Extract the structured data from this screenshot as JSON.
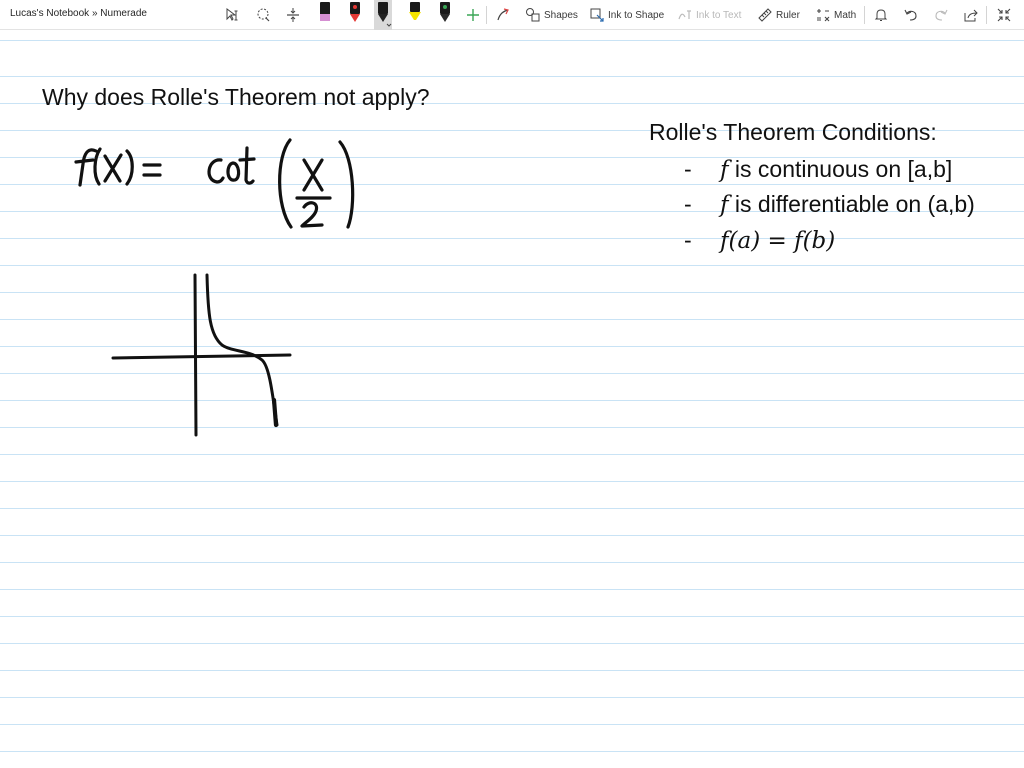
{
  "toolbar": {
    "breadcrumb": "Lucas's Notebook » Numerade",
    "shapes_label": "Shapes",
    "ink_to_shape_label": "Ink to Shape",
    "ink_to_text_label": "Ink to Text",
    "ruler_label": "Ruler",
    "math_label": "Math",
    "pen_colors": [
      "#d58fd2",
      "#e53935",
      "#222222",
      "#f5e400",
      "#2a2a2a"
    ],
    "accent_color": "#3aa655"
  },
  "page": {
    "question": "Why does Rolle's Theorem not apply?",
    "conditions_title": "Rolle's Theorem Conditions:",
    "conditions": [
      {
        "dash": "-",
        "var": "f",
        "text": " is continuous on [a,b]"
      },
      {
        "dash": "-",
        "var": "f",
        "text": " is differentiable on (a,b)"
      },
      {
        "dash": "-",
        "var": "f(a) = f(b)",
        "text": ""
      }
    ],
    "line_color": "#c9e3f5",
    "ink_color": "#111111"
  }
}
